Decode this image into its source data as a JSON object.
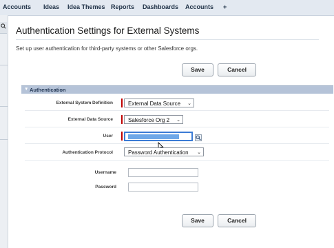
{
  "nav": {
    "items": [
      "Accounts",
      "Ideas",
      "Idea Themes",
      "Reports",
      "Dashboards",
      "Accounts",
      "+"
    ]
  },
  "page": {
    "title": "Authentication Settings for External Systems",
    "description": "Set up user authentication for third-party systems or other Salesforce orgs."
  },
  "buttons": {
    "save": "Save",
    "cancel": "Cancel"
  },
  "section": {
    "title": "Authentication"
  },
  "form": {
    "external_system_definition": {
      "label": "External System Definition",
      "value": "External Data Source"
    },
    "external_data_source": {
      "label": "External Data Source",
      "value": "Salesforce Org 2"
    },
    "user": {
      "label": "User",
      "value": ""
    },
    "authentication_protocol": {
      "label": "Authentication Protocol",
      "value": "Password Authentication"
    },
    "username": {
      "label": "Username",
      "value": ""
    },
    "password": {
      "label": "Password",
      "value": ""
    }
  },
  "icons": {
    "nav_search": "search-icon",
    "section_toggle": "triangle-down-icon",
    "lookup": "lookup-icon",
    "cursor": "mouse-cursor-icon",
    "dropdown": "chevron-down-icon"
  },
  "colors": {
    "nav_bg": "#e3e9f1",
    "section_header": "#b5c3d8",
    "required": "#c00000",
    "focus": "#3a7bd5",
    "selection": "#6fa8e8"
  }
}
